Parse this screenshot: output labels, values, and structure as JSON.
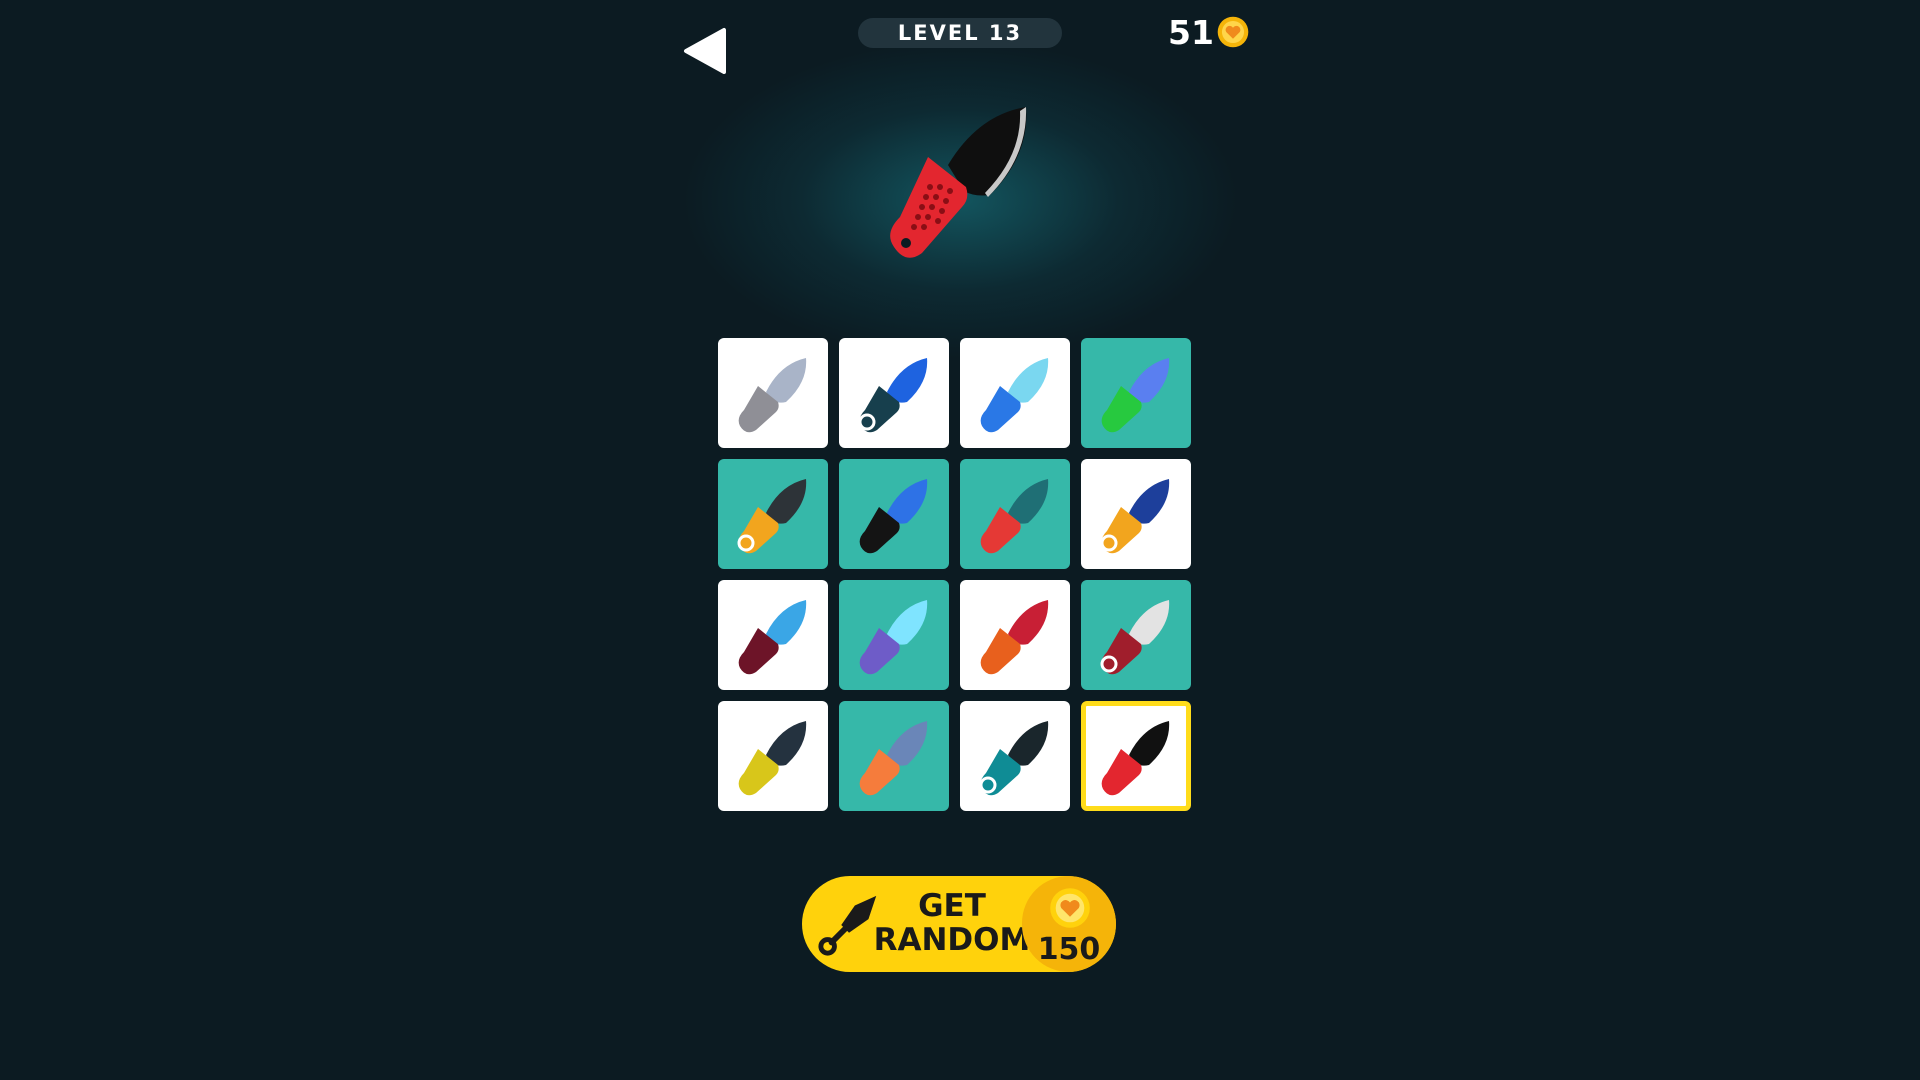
{
  "header": {
    "back_icon": "back-triangle-icon",
    "level_label": "LEVEL 13",
    "coin_count": "51",
    "coin_icon": "coin-icon"
  },
  "preview": {
    "selected_knife_icon": "red-black-knife-icon"
  },
  "knife_grid": [
    {
      "name": "knife-1",
      "icon": "gray-orange-knife-icon",
      "tile": "white",
      "handle": "#8f8f96",
      "blade": "#a9b4c8"
    },
    {
      "name": "knife-2",
      "icon": "blue-karambit-icon",
      "tile": "white",
      "handle": "#173f4d",
      "blade": "#1e63e0"
    },
    {
      "name": "knife-3",
      "icon": "blue-dagger-icon",
      "tile": "white",
      "handle": "#2a78e6",
      "blade": "#7ad7f0"
    },
    {
      "name": "knife-4",
      "icon": "green-cleaver-icon",
      "tile": "teal",
      "handle": "#27c93f",
      "blade": "#5a7ff0"
    },
    {
      "name": "knife-5",
      "icon": "orange-ring-knife-icon",
      "tile": "teal",
      "handle": "#f2a51e",
      "blade": "#2d3338"
    },
    {
      "name": "knife-6",
      "icon": "blue-spear-knife-icon",
      "tile": "teal",
      "handle": "#141414",
      "blade": "#2e72e6"
    },
    {
      "name": "knife-7",
      "icon": "teal-trident-knife-icon",
      "tile": "teal",
      "handle": "#e53935",
      "blade": "#1f6f75"
    },
    {
      "name": "knife-8",
      "icon": "leopard-karambit-icon",
      "tile": "white",
      "handle": "#f2a51e",
      "blade": "#1d3f9b"
    },
    {
      "name": "knife-9",
      "icon": "maroon-knife-icon",
      "tile": "white",
      "handle": "#6d1428",
      "blade": "#3aa6e6"
    },
    {
      "name": "knife-10",
      "icon": "purple-knife-icon",
      "tile": "teal",
      "handle": "#6e5cc8",
      "blade": "#7fe4ff"
    },
    {
      "name": "knife-11",
      "icon": "red-orange-knife-icon",
      "tile": "white",
      "handle": "#e8601d",
      "blade": "#c81f35"
    },
    {
      "name": "knife-12",
      "icon": "serrated-karambit-icon",
      "tile": "teal",
      "handle": "#a01e2c",
      "blade": "#e3e3e3"
    },
    {
      "name": "knife-13",
      "icon": "yellow-knife-icon",
      "tile": "white",
      "handle": "#d8c61a",
      "blade": "#24323f"
    },
    {
      "name": "knife-14",
      "icon": "orange-folding-knife-icon",
      "tile": "teal",
      "handle": "#f57c3c",
      "blade": "#6a86b8"
    },
    {
      "name": "knife-15",
      "icon": "teal-karambit-icon",
      "tile": "white",
      "handle": "#0f8c95",
      "blade": "#1a262c"
    },
    {
      "name": "knife-16",
      "icon": "red-black-knife-icon",
      "tile": "white",
      "handle": "#e3262f",
      "blade": "#111111",
      "selected": true
    }
  ],
  "get_random": {
    "label_line1": "GET",
    "label_line2": "RANDOM",
    "price": "150",
    "icon": "kunai-icon",
    "price_icon": "coin-icon"
  },
  "colors": {
    "background": "#0c1b22",
    "tile_white": "#ffffff",
    "tile_teal": "#36b8a9",
    "selection_border": "#ffdc1a",
    "button_yellow": "#ffd20c",
    "coin_gold": "#f5b409"
  }
}
